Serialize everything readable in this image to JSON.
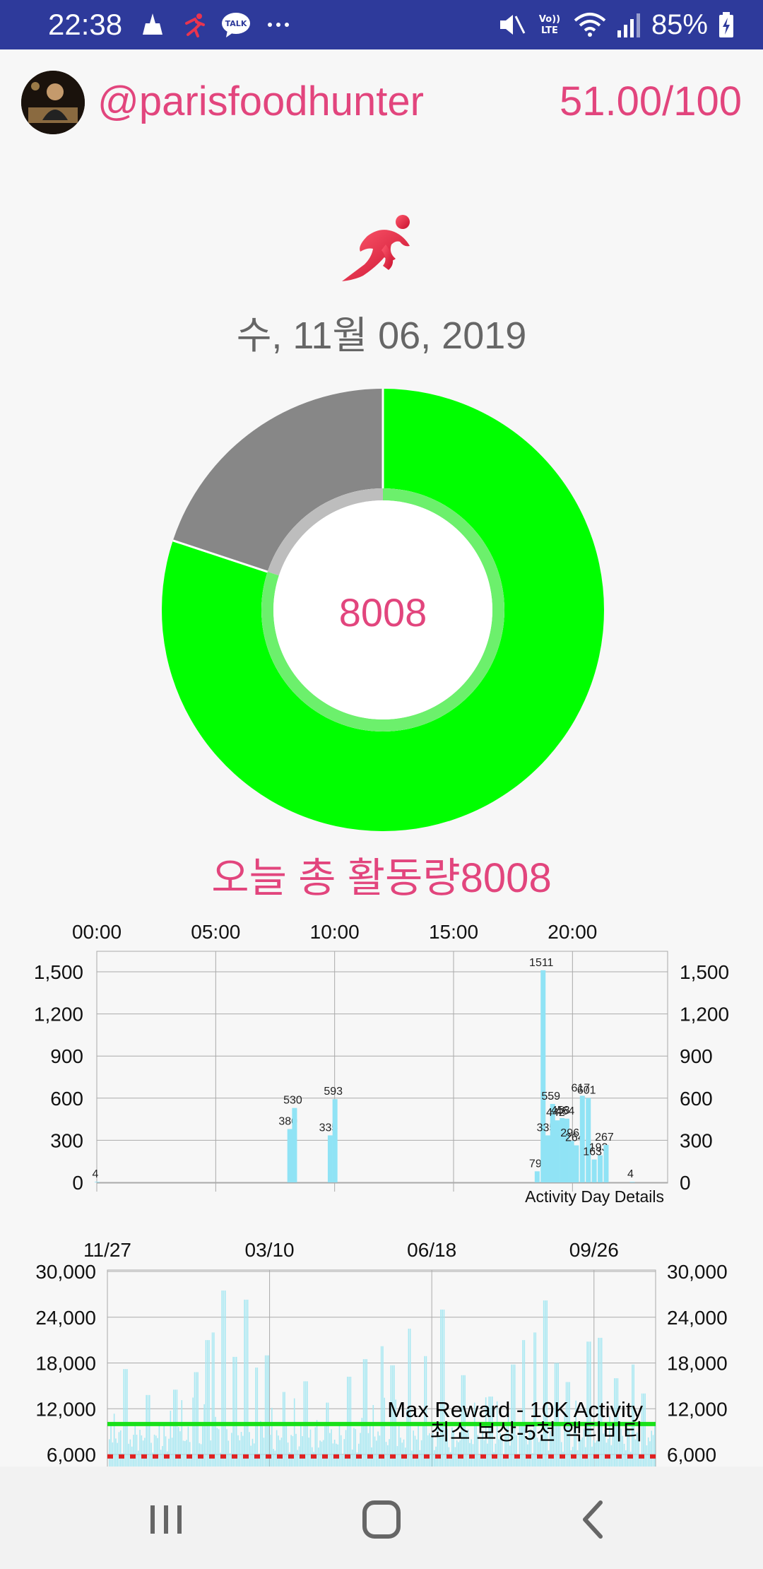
{
  "status_bar": {
    "time": "22:38",
    "left_icons": [
      "cleaner-icon",
      "running-app-icon",
      "kakaotalk-icon",
      "more-dots-icon"
    ],
    "talk_label": "TALK",
    "volte_label": "Vo)) LTE",
    "right_icons": [
      "mute-icon",
      "volte-icon",
      "wifi-icon",
      "signal-icon",
      "battery-charging-icon"
    ],
    "battery": "85%"
  },
  "profile": {
    "username": "@parisfoodhunter",
    "score": "51.00/100"
  },
  "date": "수, 11월 06, 2019",
  "donut": {
    "center_value": "8008",
    "fraction": 0.8008,
    "colors": {
      "progress": "#00ff00",
      "remaining": "#878787",
      "inner_ring": "#bdbdbd",
      "inner_ring_progress": "#6cf06c"
    }
  },
  "total_label": "오늘 총 활동량8008",
  "day_chart": {
    "type": "bar",
    "x_tick_labels": [
      "00:00",
      "05:00",
      "10:00",
      "15:00",
      "20:00"
    ],
    "y_tick_labels": [
      "1,500",
      "1,200",
      "900",
      "600",
      "300",
      "0"
    ],
    "y_ticks": [
      1500,
      1200,
      900,
      600,
      300,
      0
    ],
    "ylim": [
      0,
      1650
    ],
    "xlim_hours": [
      0,
      24
    ],
    "footer_label": "Activity Day Details",
    "bar_color": "#90e3f5",
    "bars": [
      {
        "hour": 0.0,
        "value": 4,
        "label": "4"
      },
      {
        "hour": 8.1,
        "value": 380,
        "label": "380"
      },
      {
        "hour": 8.3,
        "value": 530,
        "label": "530"
      },
      {
        "hour": 9.8,
        "value": 335,
        "label": "335"
      },
      {
        "hour": 10.0,
        "value": 593,
        "label": "593"
      },
      {
        "hour": 18.5,
        "value": 79,
        "label": "79"
      },
      {
        "hour": 18.75,
        "value": 1511,
        "label": "1511"
      },
      {
        "hour": 18.95,
        "value": 335,
        "label": "335"
      },
      {
        "hour": 19.15,
        "value": 559,
        "label": "559"
      },
      {
        "hour": 19.35,
        "value": 442,
        "label": "442"
      },
      {
        "hour": 19.55,
        "value": 458,
        "label": "458"
      },
      {
        "hour": 19.75,
        "value": 454,
        "label": "454"
      },
      {
        "hour": 19.95,
        "value": 296,
        "label": "296"
      },
      {
        "hour": 20.15,
        "value": 264,
        "label": "264"
      },
      {
        "hour": 20.4,
        "value": 617,
        "label": "617"
      },
      {
        "hour": 20.65,
        "value": 601,
        "label": "601"
      },
      {
        "hour": 20.9,
        "value": 163,
        "label": "163"
      },
      {
        "hour": 21.15,
        "value": 193,
        "label": "193"
      },
      {
        "hour": 21.4,
        "value": 267,
        "label": "267"
      },
      {
        "hour": 22.5,
        "value": 4,
        "label": "4"
      }
    ]
  },
  "history_chart": {
    "type": "bar",
    "x_tick_labels": [
      "11/27",
      "03/10",
      "06/18",
      "09/26"
    ],
    "y_tick_labels": [
      "30,000",
      "24,000",
      "18,000",
      "12,000",
      "6,000"
    ],
    "y_ticks": [
      30000,
      24000,
      18000,
      12000,
      6000
    ],
    "ylim": [
      4200,
      30000
    ],
    "max_reward_label": "Max Reward - 10K Activity",
    "max_reward_value": 10000,
    "min_reward_label": "최소 보상-5천 액티비티",
    "min_reward_value": 5000,
    "bar_color": "#a8e8f2",
    "max_line_color": "#19e019",
    "min_line_color": "#e02020",
    "peaks": [
      {
        "x": 0.03,
        "value": 17200
      },
      {
        "x": 0.07,
        "value": 13800
      },
      {
        "x": 0.12,
        "value": 14500
      },
      {
        "x": 0.16,
        "value": 16800
      },
      {
        "x": 0.18,
        "value": 21000
      },
      {
        "x": 0.19,
        "value": 22000
      },
      {
        "x": 0.21,
        "value": 27500
      },
      {
        "x": 0.23,
        "value": 18800
      },
      {
        "x": 0.25,
        "value": 26300
      },
      {
        "x": 0.27,
        "value": 17400
      },
      {
        "x": 0.29,
        "value": 19000
      },
      {
        "x": 0.32,
        "value": 14200
      },
      {
        "x": 0.36,
        "value": 15600
      },
      {
        "x": 0.4,
        "value": 12800
      },
      {
        "x": 0.44,
        "value": 16200
      },
      {
        "x": 0.47,
        "value": 18500
      },
      {
        "x": 0.5,
        "value": 20200
      },
      {
        "x": 0.52,
        "value": 17700
      },
      {
        "x": 0.55,
        "value": 22500
      },
      {
        "x": 0.58,
        "value": 18900
      },
      {
        "x": 0.61,
        "value": 25000
      },
      {
        "x": 0.65,
        "value": 16400
      },
      {
        "x": 0.7,
        "value": 13600
      },
      {
        "x": 0.74,
        "value": 17800
      },
      {
        "x": 0.76,
        "value": 21000
      },
      {
        "x": 0.78,
        "value": 22000
      },
      {
        "x": 0.8,
        "value": 26200
      },
      {
        "x": 0.82,
        "value": 18000
      },
      {
        "x": 0.84,
        "value": 15500
      },
      {
        "x": 0.88,
        "value": 20800
      },
      {
        "x": 0.9,
        "value": 21300
      },
      {
        "x": 0.93,
        "value": 16000
      },
      {
        "x": 0.96,
        "value": 17800
      },
      {
        "x": 0.98,
        "value": 14000
      }
    ]
  },
  "nav_bar": {
    "recents_icon": "recents-icon",
    "home_icon": "home-icon",
    "back_icon": "back-icon"
  }
}
